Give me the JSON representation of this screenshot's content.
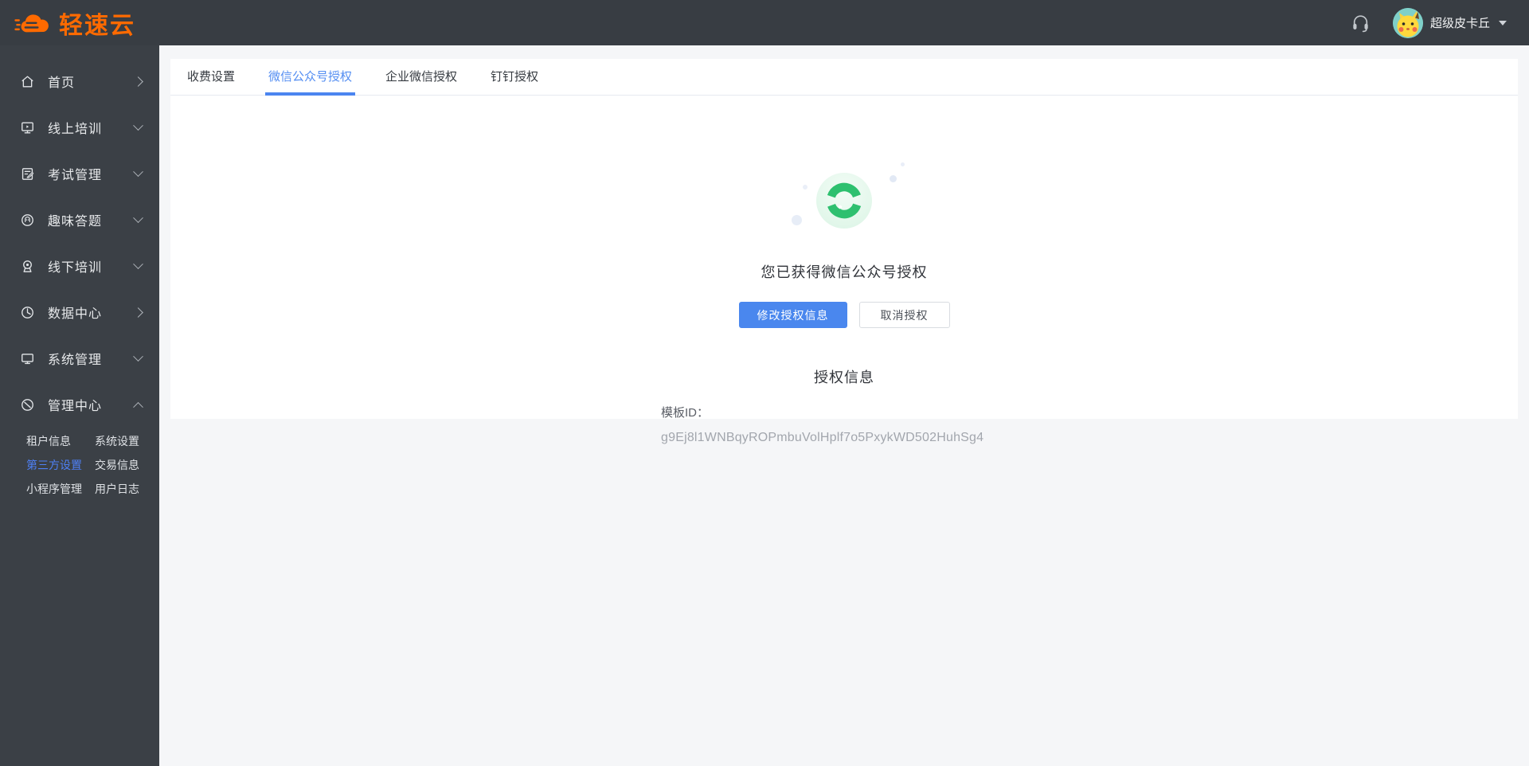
{
  "brand": {
    "name": "轻速云",
    "color": "#ff6a00"
  },
  "header": {
    "headset_icon": "headset-icon",
    "avatar_icon": "pikachu-avatar",
    "username": "超级皮卡丘"
  },
  "sidebar": {
    "items": [
      {
        "label": "首页",
        "icon": "home-icon",
        "chevron": "right"
      },
      {
        "label": "线上培训",
        "icon": "monitor-play-icon",
        "chevron": "down"
      },
      {
        "label": "考试管理",
        "icon": "exam-document-icon",
        "chevron": "down"
      },
      {
        "label": "趣味答题",
        "icon": "quiz-face-icon",
        "chevron": "down"
      },
      {
        "label": "线下培训",
        "icon": "location-pin-icon",
        "chevron": "down"
      },
      {
        "label": "数据中心",
        "icon": "pie-clock-icon",
        "chevron": "right"
      },
      {
        "label": "系统管理",
        "icon": "display-icon",
        "chevron": "down"
      },
      {
        "label": "管理中心",
        "icon": "admin-slash-icon",
        "chevron": "up",
        "expanded": true
      }
    ],
    "submenu": {
      "parent": "管理中心",
      "items": [
        {
          "label": "租户信息",
          "active": false
        },
        {
          "label": "系统设置",
          "active": false
        },
        {
          "label": "第三方设置",
          "active": true
        },
        {
          "label": "交易信息",
          "active": false
        },
        {
          "label": "小程序管理",
          "active": false
        },
        {
          "label": "用户日志",
          "active": false
        }
      ]
    }
  },
  "tabs": [
    {
      "label": "收费设置",
      "active": false
    },
    {
      "label": "微信公众号授权",
      "active": true
    },
    {
      "label": "企业微信授权",
      "active": false
    },
    {
      "label": "钉钉授权",
      "active": false
    }
  ],
  "main": {
    "wechat_logo_icon": "wechat-official-account-icon",
    "status_text": "您已获得微信公众号授权",
    "primary_button": "修改授权信息",
    "secondary_button": "取消授权",
    "section_title": "授权信息",
    "template_id_label": "模板ID：",
    "template_id_value": "g9Ej8l1WNBqyROPmbuVolHplf7o5PxykWD502HuhSg4"
  },
  "colors": {
    "brand_orange": "#ff6a00",
    "header_bg": "#383d43",
    "sidebar_bg": "#3b4046",
    "active_tab_blue": "#4b85f0",
    "submenu_active_blue": "#4e80f5",
    "primary_button_blue": "#4a87ee",
    "success_green": "#2ec06f",
    "page_bg": "#f5f6f8",
    "muted_text": "#a2a6ad"
  }
}
